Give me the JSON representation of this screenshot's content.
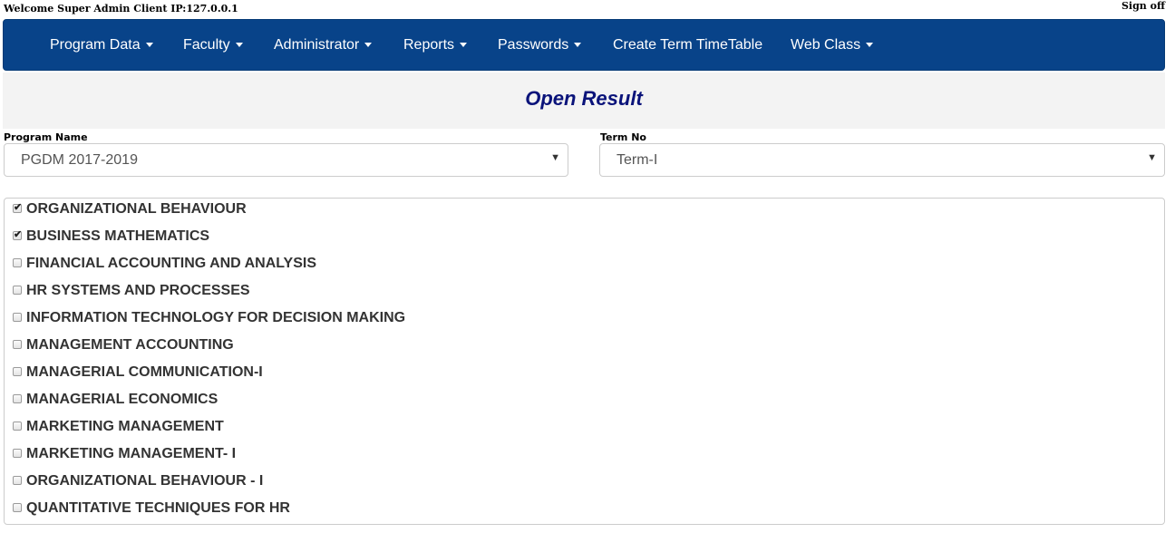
{
  "header": {
    "welcome": "Welcome Super Admin Client IP:127.0.0.1",
    "sign_off": "Sign off"
  },
  "nav": {
    "items": [
      {
        "label": "Program Data",
        "dropdown": true
      },
      {
        "label": "Faculty",
        "dropdown": true
      },
      {
        "label": "Administrator",
        "dropdown": true
      },
      {
        "label": "Reports",
        "dropdown": true
      },
      {
        "label": "Passwords",
        "dropdown": true
      },
      {
        "label": "Create Term TimeTable",
        "dropdown": false
      },
      {
        "label": "Web Class",
        "dropdown": true
      }
    ]
  },
  "page": {
    "title": "Open Result"
  },
  "filters": {
    "program": {
      "label": "Program Name",
      "value": "PGDM 2017-2019"
    },
    "term": {
      "label": "Term No",
      "value": "Term-I"
    }
  },
  "courses": [
    {
      "label": "ORGANIZATIONAL BEHAVIOUR",
      "checked": true
    },
    {
      "label": "BUSINESS MATHEMATICS",
      "checked": true
    },
    {
      "label": "FINANCIAL ACCOUNTING AND ANALYSIS",
      "checked": false
    },
    {
      "label": "HR SYSTEMS AND PROCESSES",
      "checked": false
    },
    {
      "label": "INFORMATION TECHNOLOGY FOR DECISION MAKING",
      "checked": false
    },
    {
      "label": "MANAGEMENT ACCOUNTING",
      "checked": false
    },
    {
      "label": "MANAGERIAL COMMUNICATION-I",
      "checked": false
    },
    {
      "label": "MANAGERIAL ECONOMICS",
      "checked": false
    },
    {
      "label": "MARKETING MANAGEMENT",
      "checked": false
    },
    {
      "label": "MARKETING MANAGEMENT- I",
      "checked": false
    },
    {
      "label": "ORGANIZATIONAL BEHAVIOUR - I",
      "checked": false
    },
    {
      "label": "QUANTITATIVE TECHNIQUES FOR HR",
      "checked": false
    }
  ],
  "colors": {
    "navbar": "#084389",
    "title": "#0a137a"
  }
}
